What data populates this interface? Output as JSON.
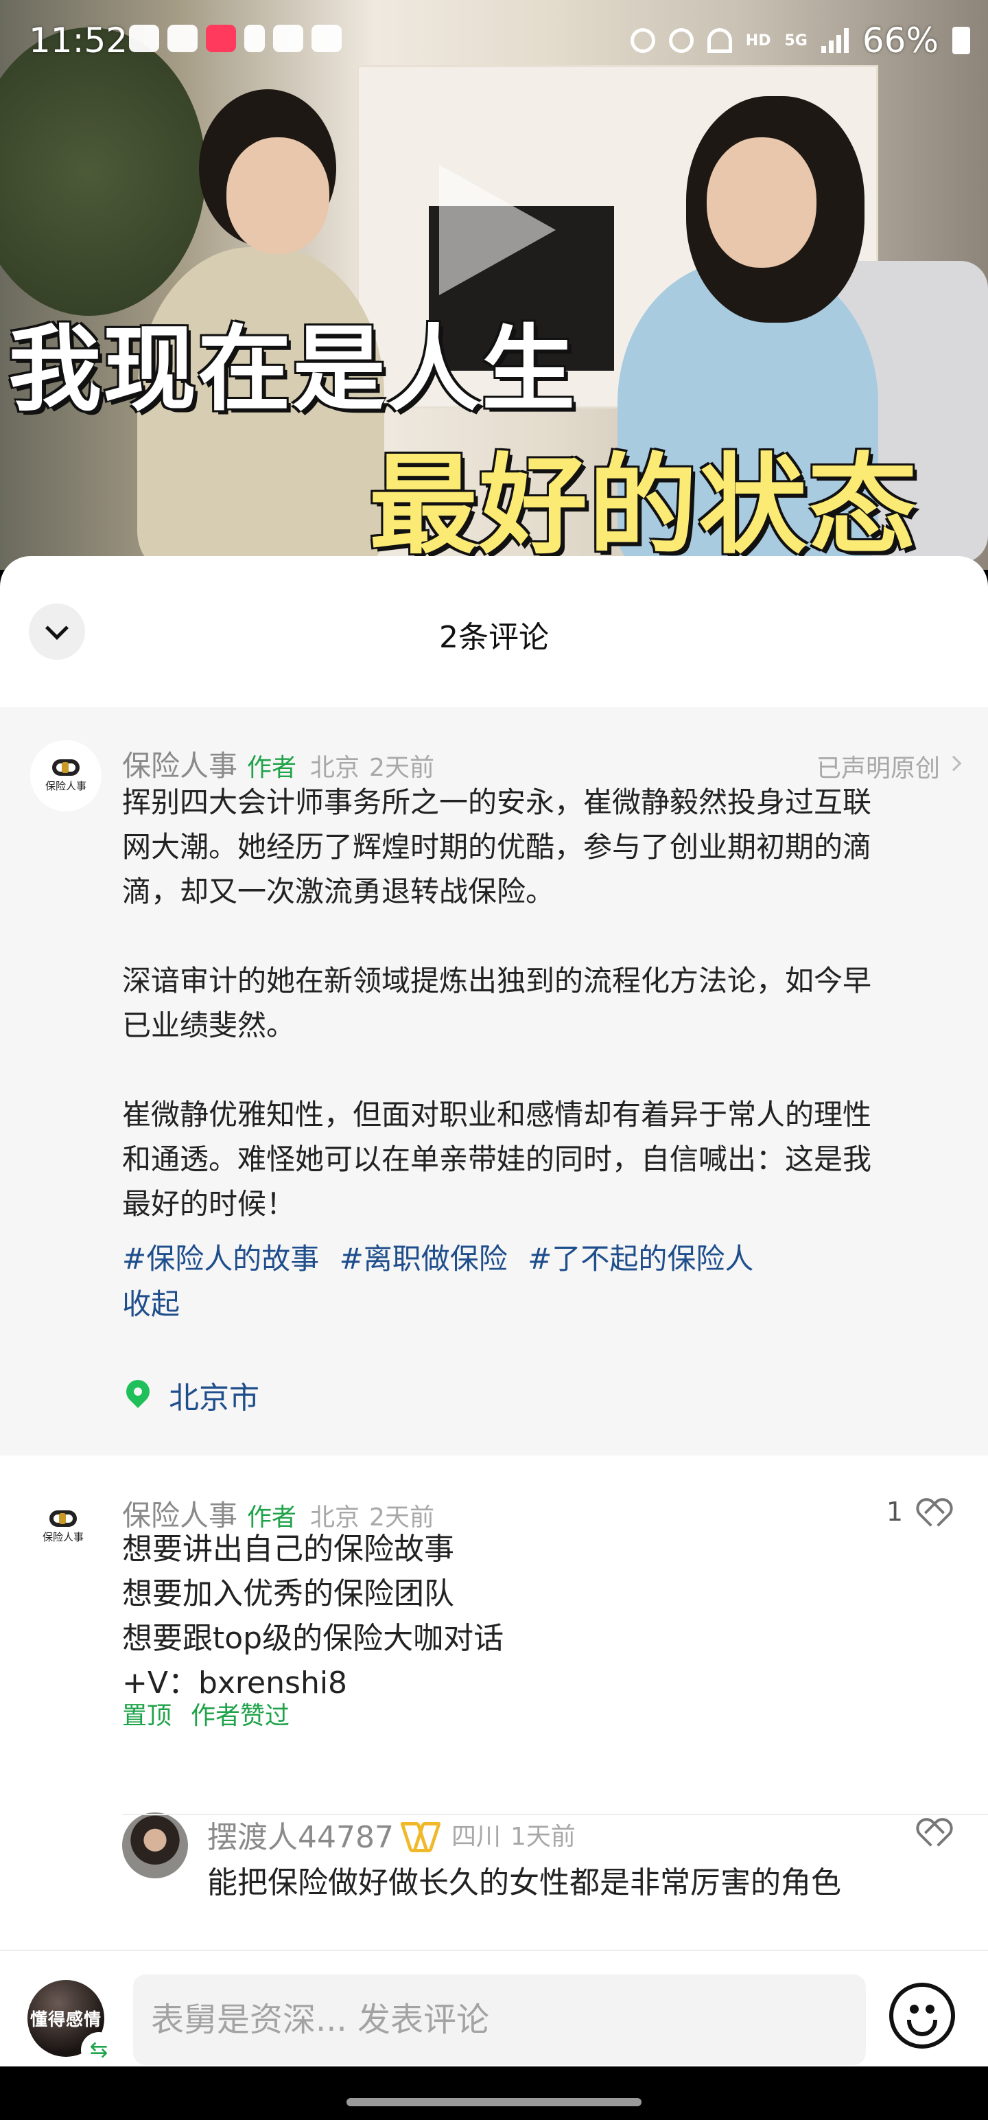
{
  "status_bar": {
    "time": "11:52",
    "battery": "66%",
    "network_label": "HD",
    "network_type": "5G"
  },
  "video": {
    "caption_line1": "我现在是人生",
    "caption_line2": "最好的状态",
    "play_icon": "play-icon"
  },
  "comments_sheet": {
    "title": "2条评论",
    "collapse_icon": "chevron-down-icon"
  },
  "author_post": {
    "avatar_text": "保险人事",
    "name": "保险人事",
    "role_tag": "作者",
    "location": "北京",
    "time": "2天前",
    "original_label": "已声明原创",
    "paragraphs": [
      "挥别四大会计师事务所之一的安永，崔微静毅然投身过互联\n网大潮。她经历了辉煌时期的优酷，参与了创业期初期的滴\n滴，却又一次激流勇退转战保险。",
      "深谙审计的她在新领域提炼出独到的流程化方法论，如今早\n已业绩斐然。",
      "崔微静优雅知性，但面对职业和感情却有着异于常人的理性\n和通透。难怪她可以在单亲带娃的同时，自信喊出：这是我\n最好的时候！"
    ],
    "hashtags": [
      "#保险人的故事",
      "#离职做保险",
      "#了不起的保险人"
    ],
    "collapse_label": "收起",
    "location_tag": "北京市"
  },
  "comment": {
    "avatar_text": "保险人事",
    "name": "保险人事",
    "role_tag": "作者",
    "location": "北京",
    "time": "2天前",
    "likes": "1",
    "text": "想要讲出自己的保险故事\n想要加入优秀的保险团队\n想要跟top级的保险大咖对话\n+V：bxrenshi8",
    "badges": [
      "置顶",
      "作者赞过"
    ]
  },
  "reply": {
    "name": "摆渡人44787",
    "location": "四川",
    "time": "1天前",
    "text": "能把保险做好做长久的女性都是非常厉害的角色"
  },
  "input_bar": {
    "avatar_text": "懂得感情",
    "placeholder": "表舅是资深... 发表评论",
    "emoji_icon": "emoji-icon"
  },
  "colors": {
    "accent_green": "#1fa34a",
    "link_blue": "#1f4e8c",
    "caption_yellow": "#fbea73"
  }
}
